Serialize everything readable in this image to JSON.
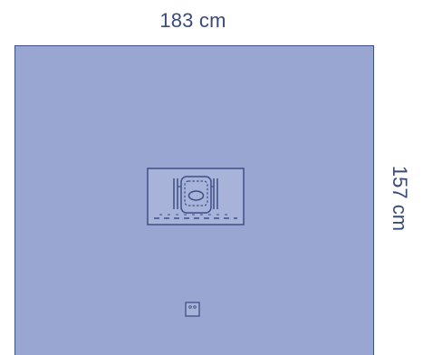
{
  "dimensions": {
    "width": "183 cm",
    "height": "157 cm"
  },
  "colors": {
    "drape_fill": "#99a6d1",
    "outline": "#3e4f86",
    "label_text": "#3a4a7a",
    "fenestration_fill": "#a8b3da"
  },
  "parts": {
    "drape": "drape-sheet",
    "fenestration": "incise-fenestration-panel",
    "holder": "cable-holder-tab"
  }
}
